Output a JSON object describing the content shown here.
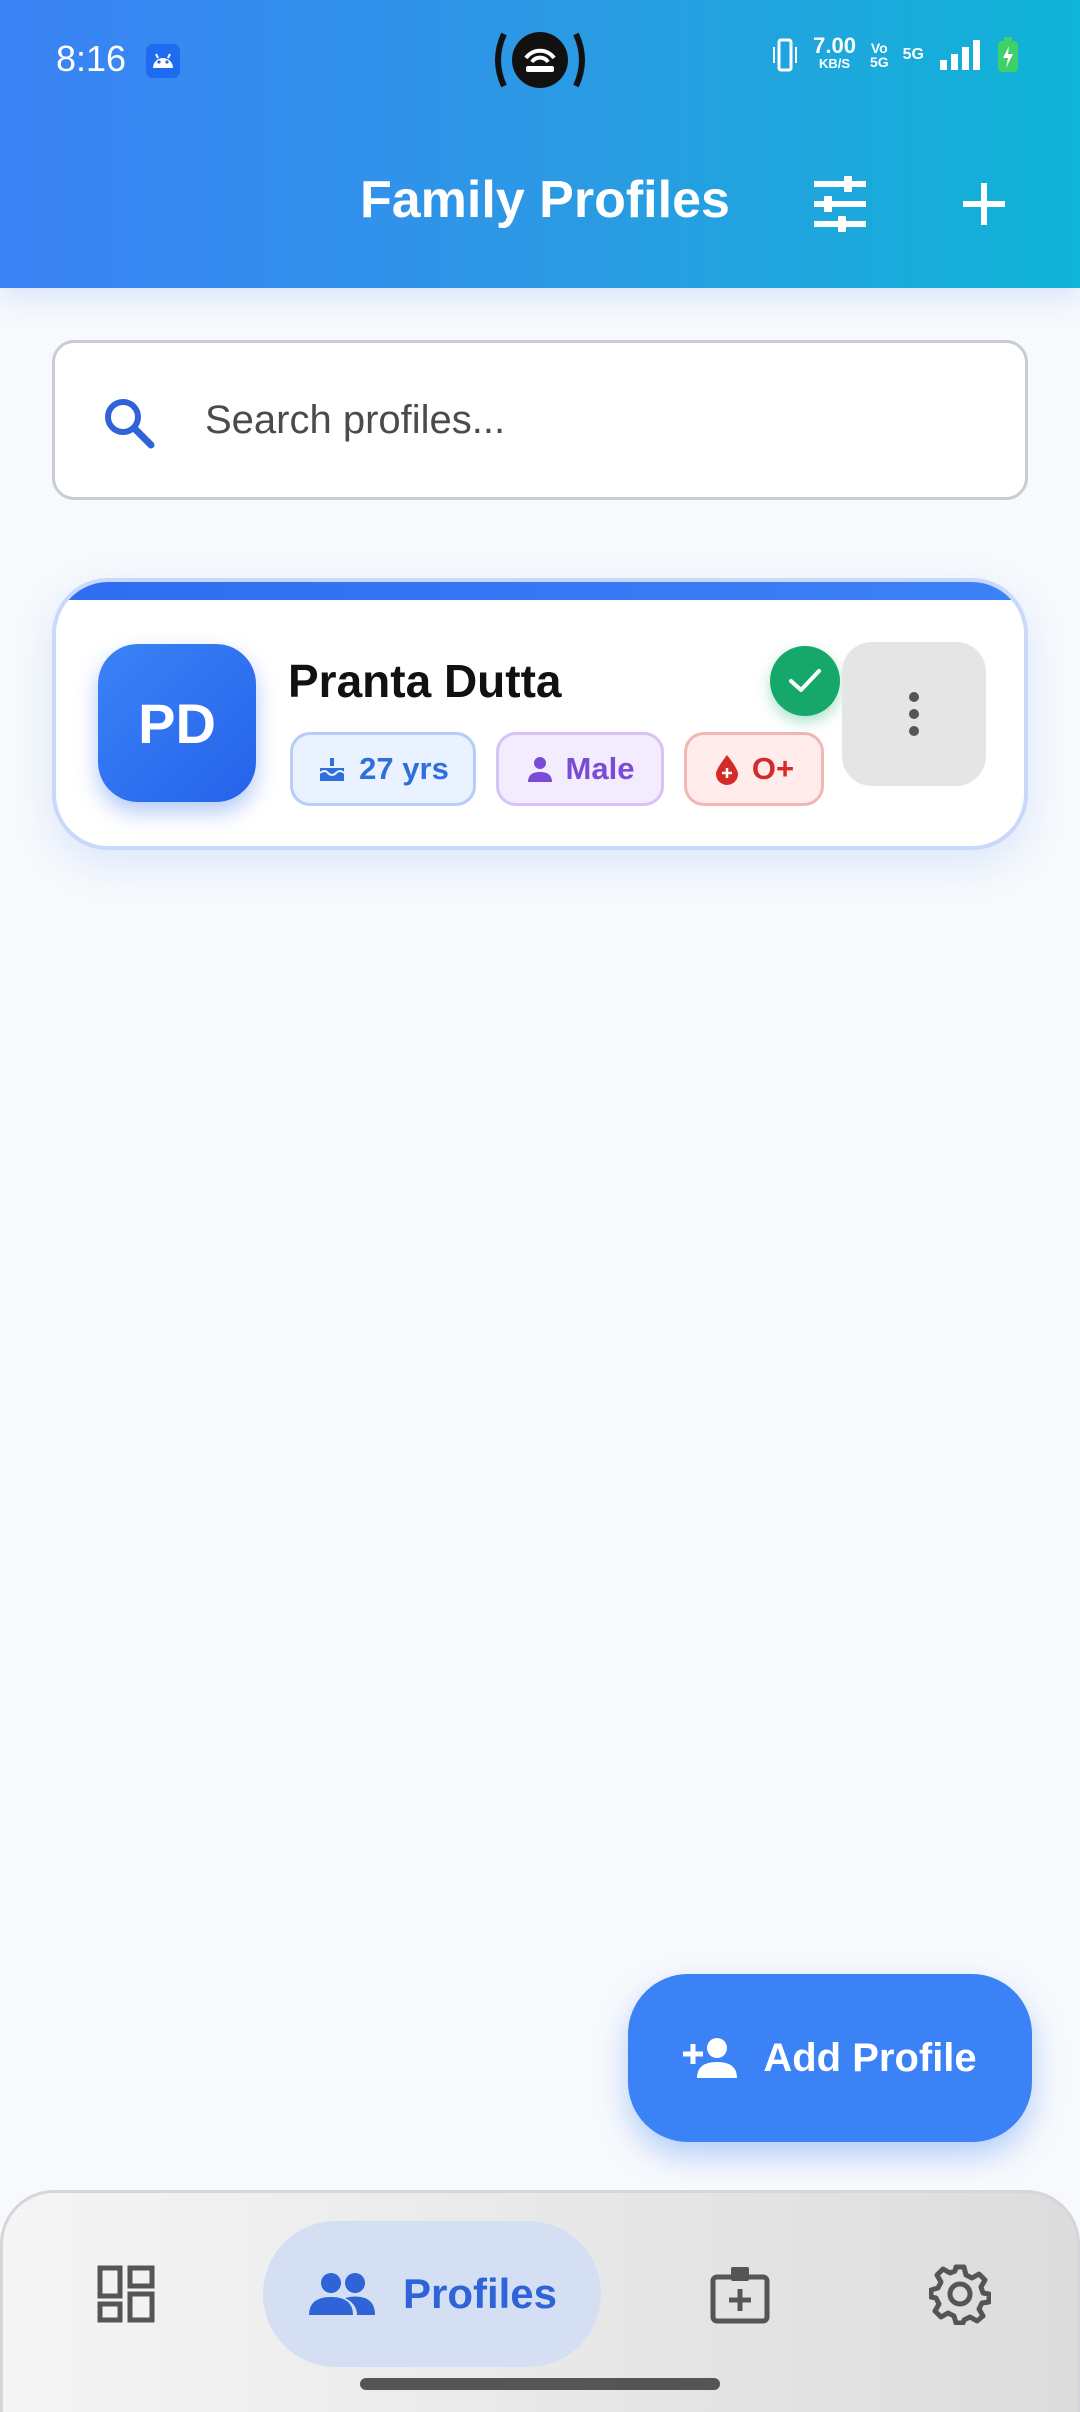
{
  "status_bar": {
    "time": "8:16",
    "speed_value": "7.00",
    "speed_unit": "KB/S",
    "volte_top": "Vo",
    "volte_bottom": "5G",
    "network": "5G"
  },
  "header": {
    "title": "Family Profiles",
    "filter_icon": "tune-icon",
    "add_icon": "plus-icon",
    "gradient_start": "#3b82f6",
    "gradient_end": "#0fb4d6"
  },
  "search": {
    "placeholder": "Search profiles...",
    "value": ""
  },
  "profiles": [
    {
      "initials": "PD",
      "name": "Pranta Dutta",
      "age": "27 yrs",
      "gender": "Male",
      "blood_group": "O+",
      "verified": true
    }
  ],
  "fab": {
    "label": "Add Profile",
    "icon": "person-add-icon",
    "color": "#3b82f6"
  },
  "bottom_nav": {
    "items": [
      {
        "icon": "dashboard-icon",
        "label": ""
      },
      {
        "icon": "people-icon",
        "label": "Profiles",
        "active": true
      },
      {
        "icon": "medical-id-icon",
        "label": ""
      },
      {
        "icon": "settings-gear-icon",
        "label": ""
      }
    ],
    "active_color": "#2f64d8"
  }
}
